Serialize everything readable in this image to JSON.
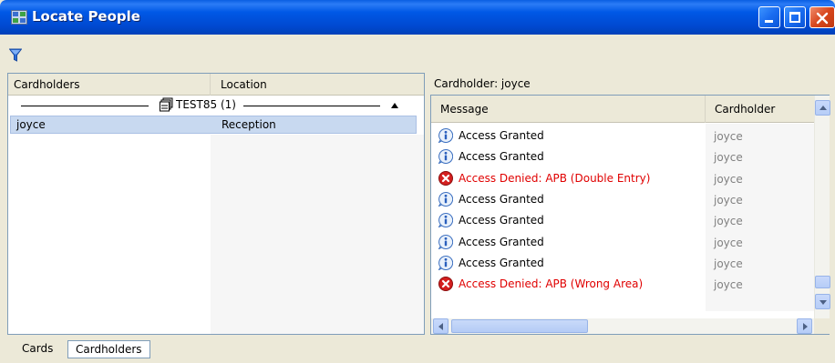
{
  "window": {
    "title": "Locate People",
    "icon": "people-app-icon",
    "controls": [
      "minimize",
      "maximize",
      "close"
    ]
  },
  "toolbar": {
    "filter_icon": "filter-funnel-icon"
  },
  "left_grid": {
    "columns": [
      "Cardholders",
      "Location"
    ],
    "group": {
      "label": "TEST85 (1)",
      "icon": "server-group-icon",
      "sort": "ascending"
    },
    "rows": [
      {
        "cardholder": "joyce",
        "location": "Reception",
        "selected": true
      }
    ]
  },
  "right_panel": {
    "label": "Cardholder: joyce",
    "columns": [
      "Message",
      "Cardholder"
    ],
    "rows": [
      {
        "type": "info",
        "message": "Access Granted",
        "cardholder": "joyce"
      },
      {
        "type": "info",
        "message": "Access Granted",
        "cardholder": "joyce"
      },
      {
        "type": "error",
        "message": "Access Denied: APB (Double Entry)",
        "cardholder": "joyce"
      },
      {
        "type": "info",
        "message": "Access Granted",
        "cardholder": "joyce"
      },
      {
        "type": "info",
        "message": "Access Granted",
        "cardholder": "joyce"
      },
      {
        "type": "info",
        "message": "Access Granted",
        "cardholder": "joyce"
      },
      {
        "type": "info",
        "message": "Access Granted",
        "cardholder": "joyce"
      },
      {
        "type": "error",
        "message": "Access Denied: APB (Wrong Area)",
        "cardholder": "joyce"
      }
    ]
  },
  "tabs": [
    {
      "label": "Cards",
      "active": false
    },
    {
      "label": "Cardholders",
      "active": true
    }
  ],
  "colors": {
    "title_bar": "#0058e6",
    "denied_text": "#e00000",
    "selection": "#c8d9f0"
  }
}
